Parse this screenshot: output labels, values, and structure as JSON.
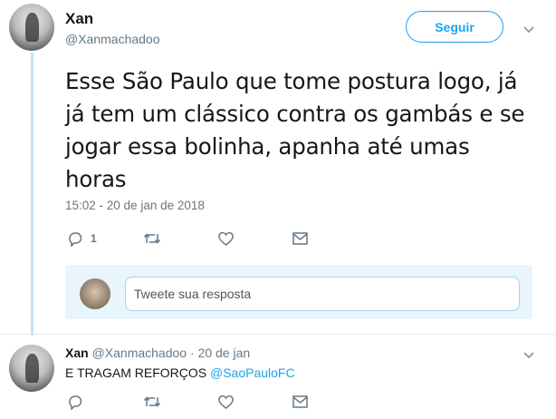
{
  "main_tweet": {
    "author_name": "Xan",
    "author_handle": "@Xanmachadoo",
    "follow_label": "Seguir",
    "text": "Esse São Paulo que tome postura logo, já já tem um clássico contra os gambás e se jogar essa bolinha, apanha até umas horas",
    "timestamp": "15:02 - 20 de jan de 2018",
    "reply_count": "1"
  },
  "reply_compose": {
    "placeholder": "Tweete sua resposta"
  },
  "reply_tweet": {
    "author_name": "Xan",
    "author_handle": "@Xanmachadoo",
    "separator": "·",
    "date": "20 de jan",
    "text": "E TRAGAM REFORÇOS",
    "mention": "@SaoPauloFC"
  },
  "colors": {
    "accent": "#1da1f2",
    "muted": "#657786",
    "thread_line": "#c4e1f6"
  },
  "icons": [
    "reply-icon",
    "retweet-icon",
    "like-icon",
    "dm-icon",
    "chevron-down-icon"
  ]
}
